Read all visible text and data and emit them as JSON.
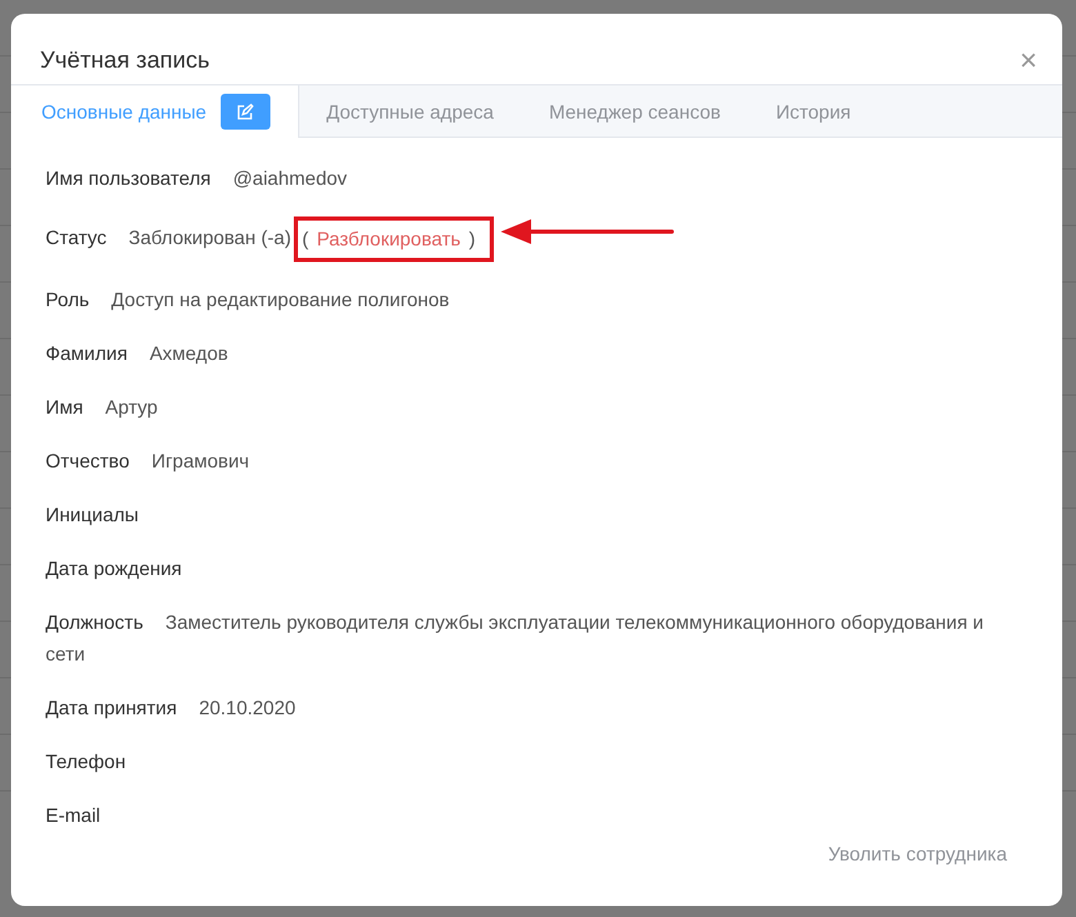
{
  "dialog": {
    "title": "Учётная запись",
    "close": "×"
  },
  "tabs": [
    {
      "label": "Основные данные",
      "selected": true,
      "edit_button": true
    },
    {
      "label": "Доступные адреса",
      "selected": false,
      "edit_button": false
    },
    {
      "label": "Менеджер сеансов",
      "selected": false,
      "edit_button": false
    },
    {
      "label": "История",
      "selected": false,
      "edit_button": false
    }
  ],
  "fields": [
    {
      "kind": "text",
      "label": "Имя пользователя",
      "value": "@aiahmedov"
    },
    {
      "kind": "status",
      "label": "Статус",
      "value": "Заблокирован (-а)",
      "open": "(",
      "link": "Разблокировать",
      "close": ")",
      "annotated": true
    },
    {
      "kind": "text",
      "label": "Роль",
      "value": "Доступ на редактирование полигонов"
    },
    {
      "kind": "text",
      "label": "Фамилия",
      "value": "Ахмедов"
    },
    {
      "kind": "text",
      "label": "Имя",
      "value": "Артур"
    },
    {
      "kind": "text",
      "label": "Отчество",
      "value": "Играмович"
    },
    {
      "kind": "text",
      "label": "Инициалы"
    },
    {
      "kind": "text",
      "label": "Дата рождения"
    },
    {
      "kind": "text",
      "label": "Должность",
      "value": "Заместитель руководителя службы эксплуатации телекоммуникационного оборудования и сети"
    },
    {
      "kind": "text",
      "label": "Дата принятия",
      "value": "20.10.2020"
    },
    {
      "kind": "text",
      "label": "Телефон"
    },
    {
      "kind": "text",
      "label": "E-mail"
    }
  ],
  "footer": {
    "dismiss_link": "Уволить сотрудника"
  }
}
